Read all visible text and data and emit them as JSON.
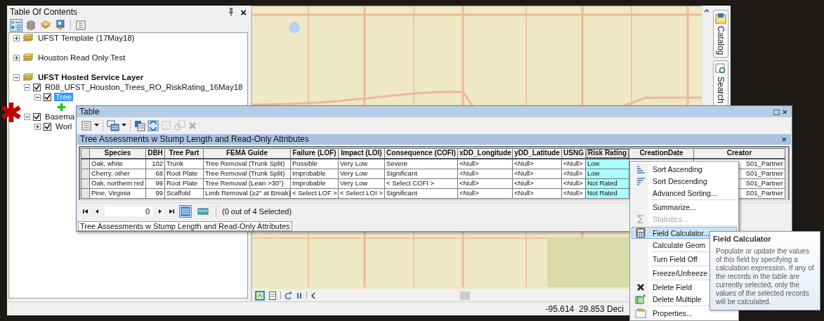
{
  "toc": {
    "title": "Table Of Contents",
    "close_glyph": "×",
    "tools": [
      {
        "selected": true
      },
      {
        "selected": false
      },
      {
        "selected": false
      },
      {
        "selected": false
      },
      {
        "selected": false
      }
    ],
    "layers": [
      {
        "label": "UFST Template (17May18)",
        "active": false,
        "expanded": false,
        "selected": false
      },
      {
        "label": "Houston Read Only Test",
        "active": false,
        "expanded": false,
        "selected": false
      },
      {
        "label": "UFST Hosted Service Layer",
        "active": true,
        "expanded": true,
        "selected": false,
        "children": [
          {
            "label": "R08_UFST_Houston_Trees_RO_RiskRating_16May18",
            "expanded": true,
            "checked": true,
            "selected": false,
            "children": [
              {
                "label": "Tree",
                "expanded": true,
                "checked": true,
                "selected": true
              }
            ]
          },
          {
            "label": "Basema",
            "expanded": true,
            "checked": true,
            "selected": false,
            "children": [
              {
                "label": "Worl",
                "expanded": false,
                "checked": true,
                "selected": false
              }
            ]
          }
        ]
      }
    ]
  },
  "map_toolbar": [
    {
      "selected": true
    },
    {
      "selected": false
    }
  ],
  "side_tabs": [
    {
      "label": "Catalog"
    },
    {
      "label": "Search"
    }
  ],
  "status_bar": {
    "coordinates": "-95.614  29.853 Deci"
  },
  "table_window": {
    "title": "Table",
    "restore_glyph": "□",
    "close_glyph": "×",
    "toolbar": [
      {
        "disabled": false
      },
      {
        "disabled": false
      },
      {
        "disabled": false
      },
      {
        "disabled": false
      },
      {
        "disabled": true
      },
      {
        "disabled": true
      },
      {
        "disabled": true
      }
    ],
    "tab": {
      "title": "Tree Assessments w Stump Length and Read-Only Attributes",
      "close_glyph": "×"
    },
    "columns": [
      {
        "label": "Species",
        "selected": false
      },
      {
        "label": "DBH",
        "selected": false
      },
      {
        "label": "Tree Part",
        "selected": false
      },
      {
        "label": "FEMA Guide",
        "selected": false
      },
      {
        "label": "Failure (LOF)",
        "selected": false
      },
      {
        "label": "Impact (LOI)",
        "selected": false
      },
      {
        "label": "Consequence (COFI)",
        "selected": false
      },
      {
        "label": "xDD_Longitude",
        "selected": false
      },
      {
        "label": "yDD_Latitude",
        "selected": false
      },
      {
        "label": "USNG",
        "selected": false
      },
      {
        "label": "Risk Rating",
        "selected": true
      },
      {
        "label": "CreationDate",
        "selected": false
      },
      {
        "label": "Creator",
        "selected": false
      }
    ],
    "rows": [
      {
        "cells": [
          "Oak, white",
          "102",
          "Trunk",
          "Tree Removal (Trunk Split)",
          "Possible",
          "Very Low",
          "Severe",
          "<Null>",
          "<Null>",
          "<Null>",
          "Low",
          "S01_Partner"
        ]
      },
      {
        "cells": [
          "Cherry, other",
          "68",
          "Root Plate",
          "Tree Removal (Trunk Split)",
          "Improbable",
          "Very Low",
          "Significant",
          "<Null>",
          "<Null>",
          "<Null>",
          "Low",
          "S01_Partner"
        ]
      },
      {
        "cells": [
          "Oak, northern red",
          "99",
          "Root Plate",
          "Tree Removal (Lean >30°)",
          "Improbable",
          "Very Low",
          "< Select COFI >",
          "<Null>",
          "<Null>",
          "<Null>",
          "Not Rated",
          "S01_Partner"
        ]
      },
      {
        "cells": [
          "Pine, Virginia",
          "99",
          "Scaffold",
          "Limb Removal (≥2\" at Break)",
          "< Select LOF >",
          "< Select LOI >",
          "Significant",
          "<Null>",
          "<Null>",
          "<Null>",
          "Not Rated",
          "S01_Partner"
        ]
      }
    ],
    "record": "0",
    "show_all": true,
    "selection_count": "(0 out of 4 Selected)",
    "bottom_tab": "Tree Assessments w Stump Length and Read-Only Attributes"
  },
  "context_menu": {
    "items": [
      {
        "kind": "item",
        "label": "Sort Ascending",
        "disabled": false,
        "highlighted": false
      },
      {
        "kind": "item",
        "label": "Sort Descending",
        "disabled": false,
        "highlighted": false
      },
      {
        "kind": "item",
        "label": "Advanced Sorting...",
        "disabled": false,
        "highlighted": false
      },
      {
        "kind": "separator"
      },
      {
        "kind": "item",
        "label": "Summarize...",
        "disabled": false,
        "highlighted": false
      },
      {
        "kind": "item",
        "label": "Statistics...",
        "disabled": true,
        "highlighted": false
      },
      {
        "kind": "separator"
      },
      {
        "kind": "item",
        "label": "Field Calculator...",
        "disabled": false,
        "highlighted": true
      },
      {
        "kind": "item",
        "label": "Calculate Geom",
        "disabled": false,
        "highlighted": false
      },
      {
        "kind": "separator"
      },
      {
        "kind": "item",
        "label": "Turn Field Off",
        "disabled": false,
        "highlighted": false
      },
      {
        "kind": "separator"
      },
      {
        "kind": "item",
        "label": "Freeze/Unfreeze",
        "disabled": false,
        "highlighted": false
      },
      {
        "kind": "separator"
      },
      {
        "kind": "item",
        "label": "Delete Field",
        "disabled": false,
        "highlighted": false
      },
      {
        "kind": "item",
        "label": "Delete Multiple",
        "disabled": false,
        "highlighted": false
      },
      {
        "kind": "separator"
      },
      {
        "kind": "item",
        "label": "Properties...",
        "disabled": false,
        "highlighted": false
      }
    ]
  },
  "tooltip": {
    "title": "Field Calculator",
    "text": "Populate or update the values of this field by specifying a calculation expression. If any of the records in the table are currently selected, only the values of the selected records will be calculated."
  }
}
